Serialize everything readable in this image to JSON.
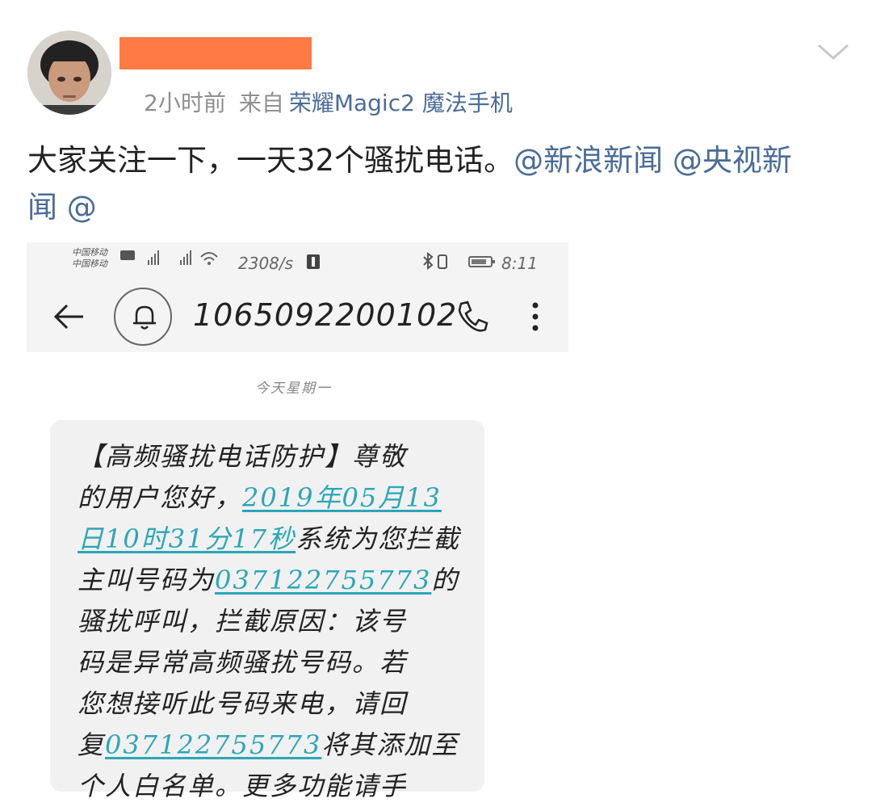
{
  "post": {
    "time": "2小时前",
    "from_label": "来自",
    "source": "荣耀Magic2 魔法手机",
    "text_main": "大家关注一下，一天32个骚扰电话。",
    "mentions": [
      "@新浪新闻",
      "@央视新",
      "闻",
      "@"
    ]
  },
  "screenshot": {
    "status": {
      "carrier_line1": "中国移动",
      "carrier_line2": "中国移动",
      "data_rate": "2308/s",
      "time": "8:11"
    },
    "header": {
      "phone_number": "1065092200102"
    },
    "date_separator": "今天星期一",
    "message": {
      "line1": "【高频骚扰电话防护】尊敬",
      "line2_prefix": "的用户您好，",
      "line2_link": "2019年05月13",
      "line3_link": "日10时31分17秒",
      "line3_suffix": "系统为您拦截",
      "line4_prefix": "主叫号码为",
      "line4_link": "037122755773",
      "line4_suffix": "的",
      "line5": "骚扰呼叫，拦截原因：该号",
      "line6": "码是异常高频骚扰号码。若",
      "line7": "您想接听此号码来电，请回",
      "line8_prefix": "复",
      "line8_link": "037122755773",
      "line8_suffix": "将其添加至",
      "line9": "个人白名单。更多功能请手"
    }
  },
  "colors": {
    "mention": "#4a6c97",
    "link": "#2aa7b8",
    "redaction": "#ff7a45"
  }
}
